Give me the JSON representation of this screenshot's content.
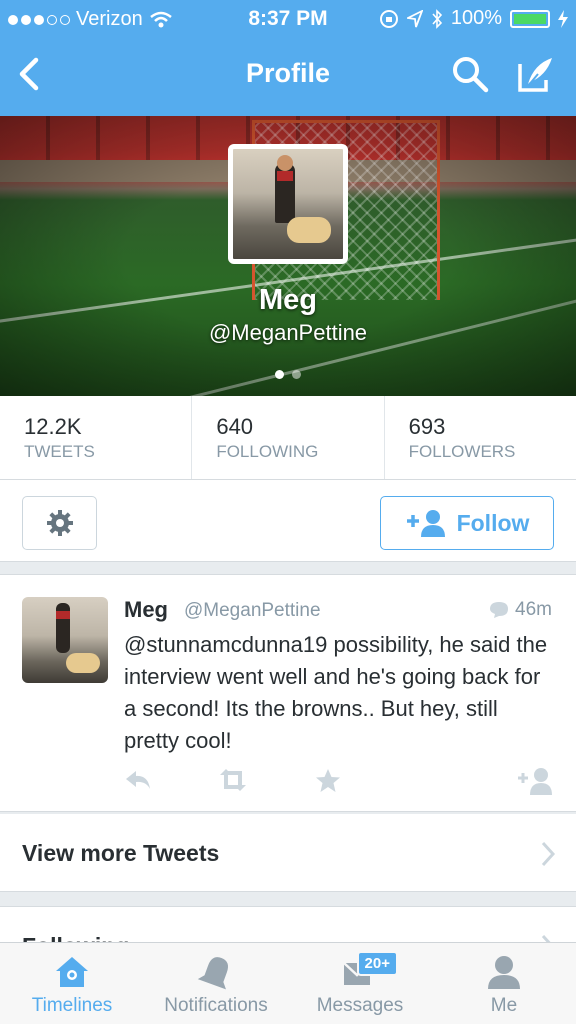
{
  "status_bar": {
    "carrier": "Verizon",
    "time": "8:37 PM",
    "battery": "100%"
  },
  "nav": {
    "title": "Profile"
  },
  "profile": {
    "name": "Meg",
    "handle": "@MeganPettine"
  },
  "stats": [
    {
      "value": "12.2K",
      "label": "TWEETS"
    },
    {
      "value": "640",
      "label": "FOLLOWING"
    },
    {
      "value": "693",
      "label": "FOLLOWERS"
    }
  ],
  "actions": {
    "follow_label": "Follow"
  },
  "tweet": {
    "name": "Meg",
    "handle": "@MeganPettine",
    "time": "46m",
    "text": "@stunnamcdunna19 possibility, he said the interview went well and he's going back for a second! Its the browns.. But hey, still pretty cool!"
  },
  "links": {
    "view_more": "View more Tweets",
    "following": "Following"
  },
  "tabs": [
    {
      "label": "Timelines",
      "icon": "home-icon"
    },
    {
      "label": "Notifications",
      "icon": "bell-icon"
    },
    {
      "label": "Messages",
      "icon": "messages-icon",
      "badge": "20+"
    },
    {
      "label": "Me",
      "icon": "person-icon"
    }
  ],
  "colors": {
    "accent": "#55acee",
    "muted": "#8899a6",
    "text": "#292f33",
    "battery": "#4cd964"
  }
}
